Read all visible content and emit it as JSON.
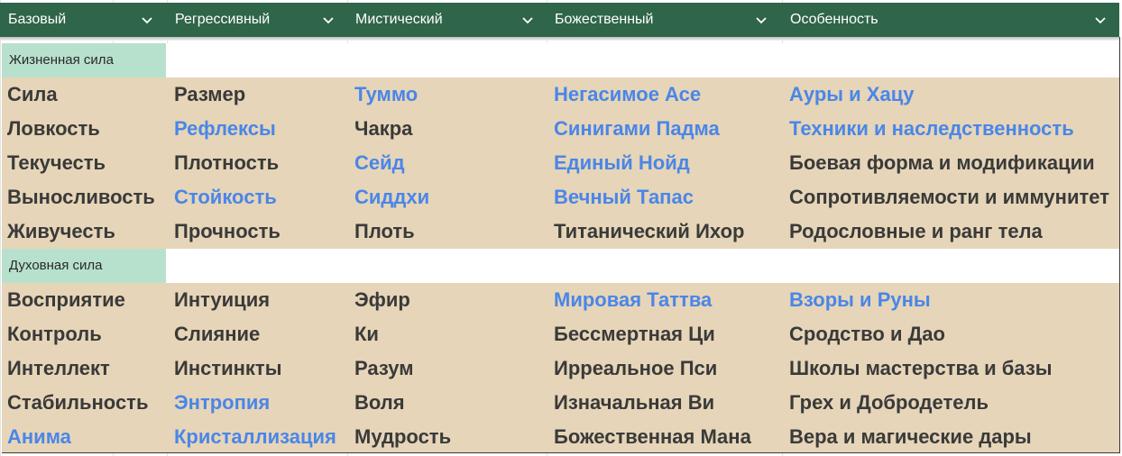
{
  "colors": {
    "header_bg": "#2f6549",
    "section_bg": "#b7e1cd",
    "row_bg": "#e6d5b8",
    "link_blue": "#4a86e8",
    "text_dark": "#3a3a3a"
  },
  "header": {
    "columns": [
      "Базовый",
      "Регрессивный",
      "Мистический",
      "Божественный",
      "Особенность"
    ],
    "chevron_icon": "chevron-down-icon"
  },
  "sections": [
    {
      "label": "Жизненная сила",
      "rows": [
        [
          {
            "t": "Сила",
            "c": "dark"
          },
          {
            "t": "Размер",
            "c": "dark"
          },
          {
            "t": "Туммо",
            "c": "blue"
          },
          {
            "t": "Негасимое Асе",
            "c": "blue"
          },
          {
            "t": "Ауры и Хацу",
            "c": "blue"
          }
        ],
        [
          {
            "t": "Ловкость",
            "c": "dark"
          },
          {
            "t": "Рефлексы",
            "c": "blue"
          },
          {
            "t": "Чакра",
            "c": "dark"
          },
          {
            "t": "Синигами Падма",
            "c": "blue"
          },
          {
            "t": "Техники и наследственность",
            "c": "blue"
          }
        ],
        [
          {
            "t": "Текучесть",
            "c": "dark"
          },
          {
            "t": "Плотность",
            "c": "dark"
          },
          {
            "t": "Сейд",
            "c": "blue"
          },
          {
            "t": "Единый Нойд",
            "c": "blue"
          },
          {
            "t": "Боевая форма и модификации",
            "c": "dark"
          }
        ],
        [
          {
            "t": "Выносливость",
            "c": "dark"
          },
          {
            "t": "Стойкость",
            "c": "blue"
          },
          {
            "t": "Сиддхи",
            "c": "blue"
          },
          {
            "t": "Вечный Тапас",
            "c": "blue"
          },
          {
            "t": "Сопротивляемости и иммунитет",
            "c": "dark"
          }
        ],
        [
          {
            "t": "Живучесть",
            "c": "dark"
          },
          {
            "t": "Прочность",
            "c": "dark"
          },
          {
            "t": "Плоть",
            "c": "dark"
          },
          {
            "t": "Титанический Ихор",
            "c": "dark"
          },
          {
            "t": "Родословные и ранг тела",
            "c": "dark"
          }
        ]
      ]
    },
    {
      "label": "Духовная сила",
      "rows": [
        [
          {
            "t": "Восприятие",
            "c": "dark"
          },
          {
            "t": "Интуиция",
            "c": "dark"
          },
          {
            "t": "Эфир",
            "c": "dark"
          },
          {
            "t": "Мировая Таттва",
            "c": "blue"
          },
          {
            "t": "Взоры и Руны",
            "c": "blue"
          }
        ],
        [
          {
            "t": "Контроль",
            "c": "dark"
          },
          {
            "t": "Слияние",
            "c": "dark"
          },
          {
            "t": "Ки",
            "c": "dark"
          },
          {
            "t": "Бессмертная Ци",
            "c": "dark"
          },
          {
            "t": "Сродство и Дао",
            "c": "dark"
          }
        ],
        [
          {
            "t": "Интеллект",
            "c": "dark"
          },
          {
            "t": "Инстинкты",
            "c": "dark"
          },
          {
            "t": "Разум",
            "c": "dark"
          },
          {
            "t": "Ирреальное Пси",
            "c": "dark"
          },
          {
            "t": "Школы мастерства и базы",
            "c": "dark"
          }
        ],
        [
          {
            "t": "Стабильность",
            "c": "dark"
          },
          {
            "t": "Энтропия",
            "c": "blue"
          },
          {
            "t": "Воля",
            "c": "dark"
          },
          {
            "t": "Изначальная Ви",
            "c": "dark"
          },
          {
            "t": "Грех и Добродетель",
            "c": "dark"
          }
        ],
        [
          {
            "t": "Анима",
            "c": "blue"
          },
          {
            "t": "Кристаллизация",
            "c": "blue"
          },
          {
            "t": "Мудрость",
            "c": "dark"
          },
          {
            "t": "Божественная Мана",
            "c": "dark"
          },
          {
            "t": "Вера и магические дары",
            "c": "dark"
          }
        ]
      ]
    }
  ]
}
